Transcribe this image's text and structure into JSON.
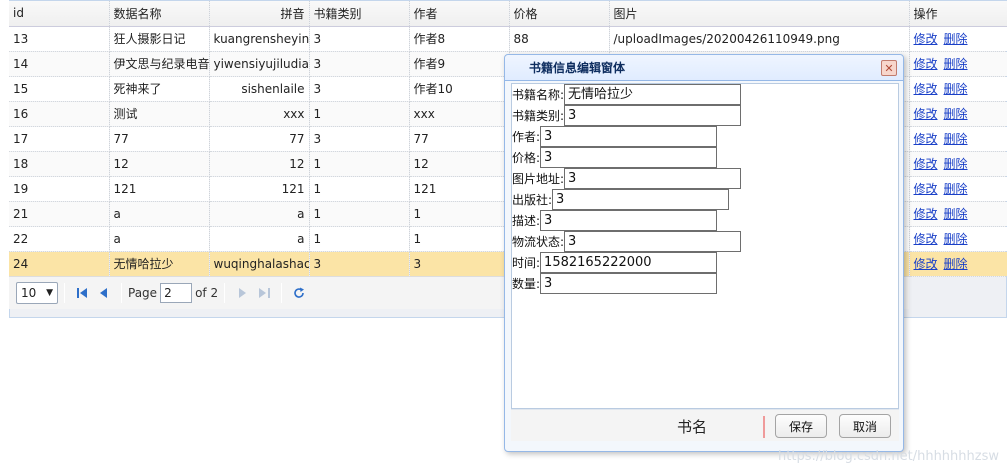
{
  "grid": {
    "columns": [
      "id",
      "数据名称",
      "拼音",
      "书籍类别",
      "作者",
      "价格",
      "图片",
      "操作"
    ],
    "rows": [
      {
        "id": "13",
        "name": "狂人摄影日记",
        "pinyin": "kuangrensheying",
        "category": "3",
        "author": "作者8",
        "price": "88",
        "image": "/uploadImages/20200426110949.png"
      },
      {
        "id": "14",
        "name": "伊文思与纪录电音",
        "pinyin": "yiwensiyujiludian",
        "category": "3",
        "author": "作者9",
        "price": "",
        "image": ""
      },
      {
        "id": "15",
        "name": "死神来了",
        "pinyin": "sishenlaile",
        "category": "3",
        "author": "作者10",
        "price": "",
        "image": ""
      },
      {
        "id": "16",
        "name": "测试",
        "pinyin": "xxx",
        "category": "1",
        "author": "xxx",
        "price": "",
        "image": ""
      },
      {
        "id": "17",
        "name": "77",
        "pinyin": "77",
        "category": "3",
        "author": "77",
        "price": "",
        "image": ""
      },
      {
        "id": "18",
        "name": "12",
        "pinyin": "12",
        "category": "1",
        "author": "12",
        "price": "",
        "image": ""
      },
      {
        "id": "19",
        "name": "121",
        "pinyin": "121",
        "category": "1",
        "author": "121",
        "price": "",
        "image": ""
      },
      {
        "id": "21",
        "name": "a",
        "pinyin": "a",
        "category": "1",
        "author": "1",
        "price": "",
        "image": ""
      },
      {
        "id": "22",
        "name": "a",
        "pinyin": "a",
        "category": "1",
        "author": "1",
        "price": "",
        "image": ""
      },
      {
        "id": "24",
        "name": "无情哈拉少",
        "pinyin": "wuqinghalashao",
        "category": "3",
        "author": "3",
        "price": "",
        "image": ""
      }
    ],
    "selected_row": 9,
    "edit_label": "修改",
    "delete_label": "删除"
  },
  "pager": {
    "page_size": "10",
    "page_label": "Page",
    "page_value": "2",
    "of_label": "of 2"
  },
  "dialog": {
    "title": "书籍信息编辑窗体",
    "close_symbol": "✕",
    "fields": [
      {
        "label": "书籍名称:",
        "value": "无情哈拉少"
      },
      {
        "label": "书籍类别:",
        "value": "3"
      },
      {
        "label": "作者:",
        "value": "3"
      },
      {
        "label": "价格:",
        "value": "3"
      },
      {
        "label": "图片地址:",
        "value": "3"
      },
      {
        "label": "出版社:",
        "value": "3"
      },
      {
        "label": "描述:",
        "value": "3"
      },
      {
        "label": "物流状态:",
        "value": "3"
      },
      {
        "label": "时间:",
        "value": "1582165222000"
      },
      {
        "label": "数量:",
        "value": "3"
      }
    ],
    "footer_label": "书名",
    "save_label": "保存",
    "cancel_label": "取消"
  },
  "watermark": "https://blog.csdn.net/hhhhhhhzsw"
}
